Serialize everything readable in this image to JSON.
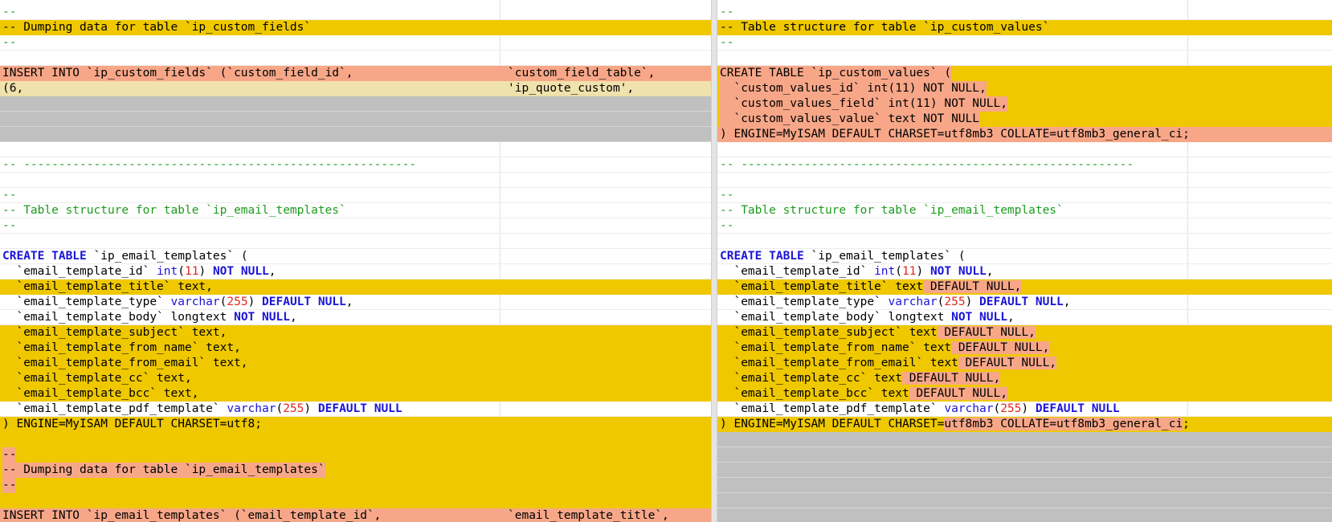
{
  "left": {
    "c1": {
      "r0": "--",
      "r1": "-- Dumping data for table `ip_custom_fields`",
      "r2": "--",
      "r4": "INSERT INTO `ip_custom_fields` (`custom_field_id`,",
      "r5": "(6,",
      "r10": "-- --------------------------------------------------------",
      "r12": "--",
      "r13": "-- Table structure for table `ip_email_templates`",
      "r14": "--",
      "r16_kw": "CREATE TABLE",
      "r16_rest": " `ip_email_templates` (",
      "r17_a": "  `email_template_id` ",
      "r17_ty": "int",
      "r17_p1": "(",
      "r17_n": "11",
      "r17_p2": ") ",
      "r17_kw": "NOT NULL",
      "r17_end": ",",
      "r18": "  `email_template_title` text,",
      "r19_a": "  `email_template_type` ",
      "r19_ty": "varchar",
      "r19_p1": "(",
      "r19_n": "255",
      "r19_p2": ") ",
      "r19_kw": "DEFAULT NULL",
      "r19_end": ",",
      "r20_a": "  `email_template_body` longtext ",
      "r20_kw": "NOT NULL",
      "r20_end": ",",
      "r21": "  `email_template_subject` text,",
      "r22": "  `email_template_from_name` text,",
      "r23": "  `email_template_from_email` text,",
      "r24": "  `email_template_cc` text,",
      "r25": "  `email_template_bcc` text,",
      "r26_a": "  `email_template_pdf_template` ",
      "r26_ty": "varchar",
      "r26_p1": "(",
      "r26_n": "255",
      "r26_p2": ") ",
      "r26_kw": "DEFAULT NULL",
      "r27": ") ENGINE=MyISAM DEFAULT CHARSET=utf8;",
      "r29": "--",
      "r30": "-- Dumping data for table `ip_email_templates`",
      "r31": "--",
      "r33": "INSERT INTO `ip_email_templates` (`email_template_id`,"
    },
    "c2": {
      "r4": "`custom_field_table`,",
      "r5": "'ip_quote_custom',",
      "r33": "`email_template_title`,"
    }
  },
  "right": {
    "r0": "--",
    "r1": "-- Table structure for table `ip_custom_values`",
    "r2": "--",
    "r4": "CREATE TABLE `ip_custom_values` (",
    "r5": "  `custom_values_id` int(11) NOT NULL,",
    "r6": "  `custom_values_field` int(11) NOT NULL,",
    "r7": "  `custom_values_value` text NOT NULL",
    "r8": ") ENGINE=MyISAM DEFAULT CHARSET=utf8mb3 COLLATE=utf8mb3_general_ci;",
    "r10": "-- --------------------------------------------------------",
    "r12": "--",
    "r13": "-- Table structure for table `ip_email_templates`",
    "r14": "--",
    "r16_kw": "CREATE TABLE",
    "r16_rest": " `ip_email_templates` (",
    "r17_a": "  `email_template_id` ",
    "r17_ty": "int",
    "r17_p1": "(",
    "r17_n": "11",
    "r17_p2": ") ",
    "r17_kw": "NOT NULL",
    "r17_end": ",",
    "r18_a": "  `email_template_title` text",
    "r18_b": " DEFAULT NULL,",
    "r19_a": "  `email_template_type` ",
    "r19_ty": "varchar",
    "r19_p1": "(",
    "r19_n": "255",
    "r19_p2": ") ",
    "r19_kw": "DEFAULT NULL",
    "r19_end": ",",
    "r20_a": "  `email_template_body` longtext ",
    "r20_kw": "NOT NULL",
    "r20_end": ",",
    "r21_a": "  `email_template_subject` text",
    "r21_b": " DEFAULT NULL,",
    "r22_a": "  `email_template_from_name` text",
    "r22_b": " DEFAULT NULL,",
    "r23_a": "  `email_template_from_email` text",
    "r23_b": " DEFAULT NULL,",
    "r24_a": "  `email_template_cc` text",
    "r24_b": " DEFAULT NULL,",
    "r25_a": "  `email_template_bcc` text",
    "r25_b": " DEFAULT NULL,",
    "r26_a": "  `email_template_pdf_template` ",
    "r26_ty": "varchar",
    "r26_p1": "(",
    "r26_n": "255",
    "r26_p2": ") ",
    "r26_kw": "DEFAULT NULL",
    "r27_a": ") ENGINE=MyISAM DEFAULT CHARSET=",
    "r27_b": "utf8mb3 COLLATE=utf8mb3_general_ci",
    "r27_c": ";"
  },
  "colors": {
    "changed_line": "#efc800",
    "changed_text": "#f7a788",
    "modified_line": "#f0e2ac",
    "gap_line": "#c0c0c0",
    "comment": "#1c9b1c",
    "keyword": "#1a14d6",
    "number": "#e0281a"
  }
}
